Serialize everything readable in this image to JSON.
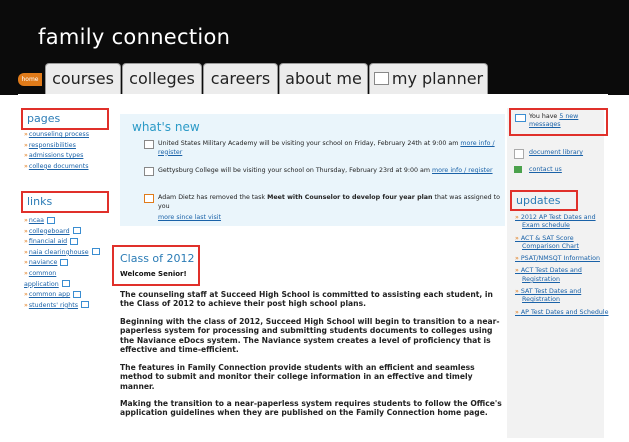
{
  "app": {
    "title": "family connection"
  },
  "tabs": [
    {
      "label": "home"
    },
    {
      "label": "courses"
    },
    {
      "label": "colleges"
    },
    {
      "label": "careers"
    },
    {
      "label": "about me"
    },
    {
      "label": "my planner"
    }
  ],
  "pages": {
    "title": "pages",
    "items": [
      "counseling process",
      "responsibilities",
      "admissions types",
      "college documents"
    ]
  },
  "links": {
    "title": "links",
    "items": [
      "ncaa",
      "collegeboard",
      "financial aid",
      "naia clearinghouse",
      "naviance",
      "common application",
      "common app",
      "students' rights"
    ]
  },
  "whats_new": {
    "title": "what's new",
    "items": [
      {
        "text": "United States Military Academy will be visiting your school on Friday, February 24th at 9:00 am",
        "link": "more info / register"
      },
      {
        "text": "Gettysburg College will be visiting your school on Thursday, February 23rd at 9:00 am",
        "link": "more info / register"
      },
      {
        "text_prefix": "Adam Dietz has removed the task ",
        "text_bold": "Meet with Counselor to develop four year plan",
        "text_suffix": " that was assigned to you"
      }
    ],
    "more_link": "more since last visit"
  },
  "class": {
    "title": "Class of 2012",
    "welcome": "Welcome Senior!",
    "paragraphs": [
      "The counseling staff at Succeed High School is committed to assisting each student, in the Class of 2012 to achieve their post high school plans.",
      "Beginning with the class of 2012, Succeed High School will begin to transition to a near-paperless system for processing and submitting students documents to colleges using the Naviance eDocs system. The Naviance system creates a level of proficiency that is effective and time-efficient.",
      "The features in Family Connection provide students with an efficient and seamless method to submit and monitor their college information in an effective and timely manner.",
      "Making the transition to a near-paperless system requires students to follow the Office's application guidelines when they are published on the Family Connection home page."
    ]
  },
  "right_panel": {
    "messages_prefix": "You have ",
    "messages_link": "5 new messages",
    "document_library": "document library",
    "contact_us": "contact us"
  },
  "updates": {
    "title": "updates",
    "items": [
      "2012 AP Test Dates and Exam schedule",
      "ACT & SAT Score Comparison Chart",
      "PSAT/NMSQT Information",
      "ACT Test Dates and Registration",
      "SAT Test Dates and Registration",
      "AP Test Dates and Schedule"
    ]
  },
  "colors": {
    "header_bg": "#0b0b0b",
    "highlight_border": "#e0302a",
    "link": "#1a62a8",
    "accent_orange": "#e07b1a",
    "whats_new_bg": "#eaf5fb"
  }
}
